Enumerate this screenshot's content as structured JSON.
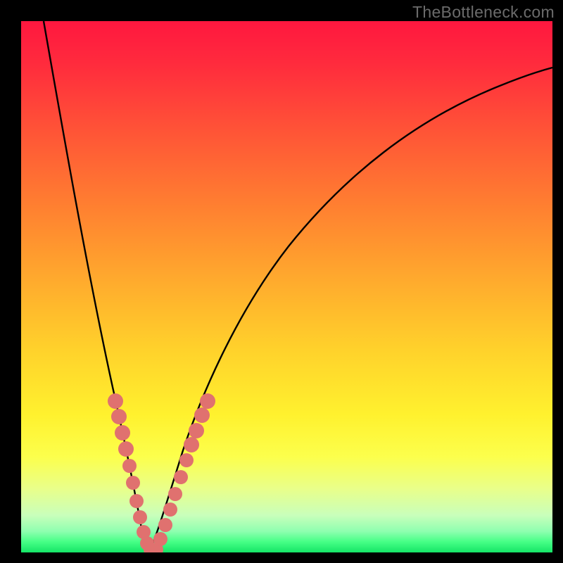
{
  "watermark": "TheBottleneck.com",
  "colors": {
    "page_bg": "#000000",
    "curve_stroke": "#000000",
    "dot_fill": "#e0716f",
    "gradient_top": "#ff173f",
    "gradient_bottom": "#15e567"
  },
  "chart_data": {
    "type": "line",
    "title": "",
    "xlabel": "",
    "ylabel": "",
    "xlim": [
      0,
      100
    ],
    "ylim": [
      0,
      100
    ],
    "notes": "V-shaped bottleneck curve over vertical red→green gradient; minimum near x≈22, y≈0. No axis ticks or numeric labels are rendered in the source image; x and y values below are normalized estimates (0–100 of plot area).",
    "series": [
      {
        "name": "curve",
        "x": [
          4,
          6,
          8,
          10,
          12,
          14,
          16,
          18,
          20,
          21,
          22,
          23,
          24,
          26,
          28,
          30,
          34,
          38,
          44,
          50,
          58,
          66,
          74,
          82,
          90,
          98,
          100
        ],
        "y": [
          100,
          88,
          76,
          64,
          52,
          41,
          31,
          21,
          10,
          5,
          1,
          3,
          6,
          12,
          18,
          23,
          32,
          40,
          49,
          56,
          65,
          72,
          78,
          83,
          87,
          90,
          91
        ]
      }
    ],
    "dots": {
      "name": "highlighted-points",
      "x_approx": [
        17.0,
        17.6,
        18.4,
        19.2,
        20.0,
        20.6,
        21.2,
        21.8,
        22.4,
        23.0,
        23.6,
        24.4,
        25.2,
        26.2,
        27.0,
        27.8,
        28.6,
        29.4,
        30.2,
        31.0
      ],
      "y_approx": [
        26,
        22,
        18,
        14,
        10,
        7,
        4,
        2,
        1,
        2,
        4,
        7,
        10,
        13,
        16,
        19,
        22,
        25,
        27,
        29
      ]
    }
  }
}
